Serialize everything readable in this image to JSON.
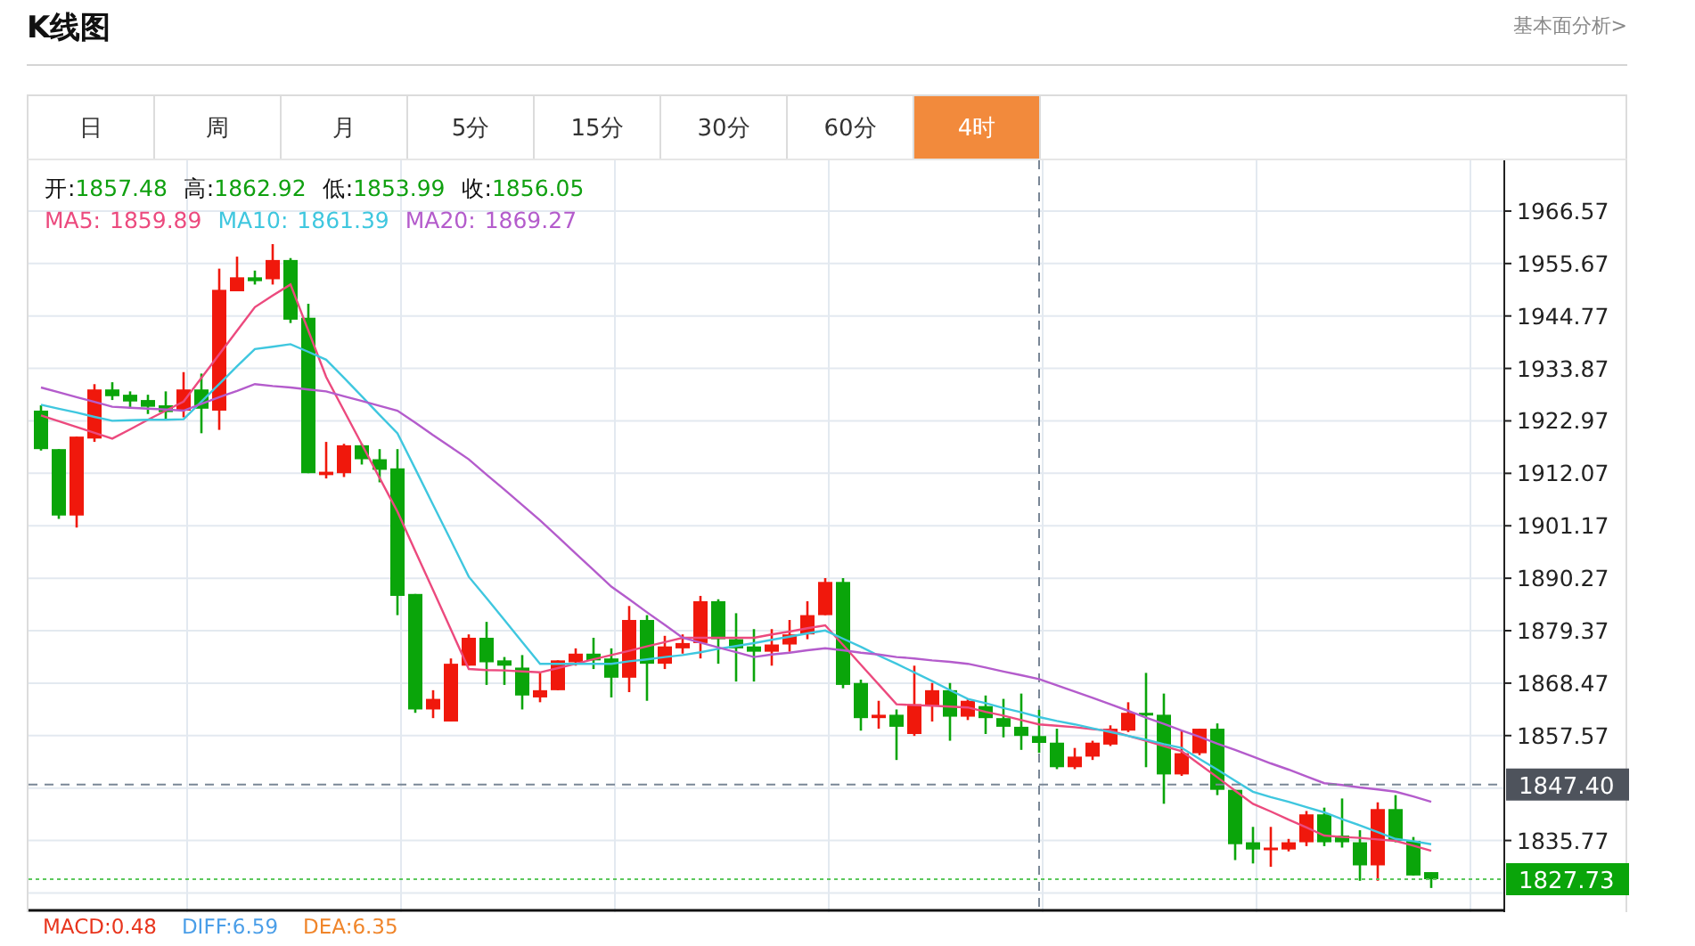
{
  "header": {
    "title": "K线图",
    "link": "基本面分析>"
  },
  "tabs": [
    {
      "label": "日",
      "selected": false
    },
    {
      "label": "周",
      "selected": false
    },
    {
      "label": "月",
      "selected": false
    },
    {
      "label": "5分",
      "selected": false
    },
    {
      "label": "15分",
      "selected": false
    },
    {
      "label": "30分",
      "selected": false
    },
    {
      "label": "60分",
      "selected": false
    },
    {
      "label": "4时",
      "selected": true
    }
  ],
  "legend": {
    "ohlc": [
      {
        "label": "开:",
        "value": "1857.48"
      },
      {
        "label": "高:",
        "value": "1862.92"
      },
      {
        "label": "低:",
        "value": "1853.99"
      },
      {
        "label": "收:",
        "value": "1856.05"
      }
    ],
    "ma": [
      "1859.89",
      "1861.39",
      "1869.27"
    ]
  },
  "chart_data": {
    "type": "candlestick",
    "grid": true,
    "ylim": [
      1821.25,
      1976.74
    ],
    "categories": [
      null,
      null,
      null,
      null,
      null,
      null,
      null,
      null,
      null,
      null,
      null,
      null,
      null,
      null,
      null,
      null,
      null,
      null,
      null,
      null,
      null,
      null,
      null,
      null,
      null,
      null,
      null,
      null,
      null,
      null,
      null,
      null,
      null,
      null,
      null,
      null,
      null,
      null,
      null,
      null,
      null,
      null,
      null,
      null,
      null,
      null,
      null,
      null,
      null,
      null,
      null,
      null,
      null,
      null,
      null,
      null,
      null,
      null,
      null,
      null,
      null,
      null,
      null,
      null,
      null,
      null,
      null,
      null,
      null,
      null,
      null,
      null,
      null,
      null,
      null,
      null,
      null,
      null,
      null
    ],
    "yticks": [
      1966.57,
      1955.67,
      1944.77,
      1933.87,
      1922.97,
      1912.07,
      1901.17,
      1890.27,
      1879.37,
      1868.47,
      1857.57,
      1835.77
    ],
    "ohlc": [
      [
        1925.1,
        1926.2,
        1916.8,
        1917.1
      ],
      [
        1917.1,
        1917.1,
        1902.6,
        1903.3
      ],
      [
        1903.3,
        1919.7,
        1900.8,
        1919.7
      ],
      [
        1919.3,
        1930.6,
        1918.6,
        1929.5
      ],
      [
        1929.5,
        1931.0,
        1927.3,
        1928.1
      ],
      [
        1928.4,
        1929.1,
        1925.5,
        1927.0
      ],
      [
        1927.3,
        1928.4,
        1924.4,
        1925.9
      ],
      [
        1926.2,
        1929.1,
        1923.3,
        1924.8
      ],
      [
        1925.1,
        1933.1,
        1923.7,
        1929.5
      ],
      [
        1929.5,
        1932.8,
        1920.4,
        1925.5
      ],
      [
        1925.1,
        1954.6,
        1921.1,
        1950.2
      ],
      [
        1949.9,
        1957.1,
        1949.9,
        1952.8
      ],
      [
        1952.8,
        1954.2,
        1951.3,
        1952.0
      ],
      [
        1952.4,
        1959.7,
        1951.3,
        1956.4
      ],
      [
        1956.4,
        1956.8,
        1943.3,
        1944.0
      ],
      [
        1944.4,
        1947.3,
        1912.1,
        1912.1
      ],
      [
        1911.7,
        1918.6,
        1911.0,
        1912.4
      ],
      [
        1912.1,
        1918.2,
        1911.3,
        1917.9
      ],
      [
        1917.9,
        1918.2,
        1913.9,
        1915.0
      ],
      [
        1915.0,
        1917.1,
        1910.2,
        1912.8
      ],
      [
        1913.1,
        1917.1,
        1882.6,
        1886.6
      ],
      [
        1887.0,
        1887.0,
        1862.3,
        1863.0
      ],
      [
        1863.0,
        1867.0,
        1861.2,
        1865.2
      ],
      [
        1860.5,
        1873.6,
        1860.5,
        1872.5
      ],
      [
        1872.1,
        1878.6,
        1872.1,
        1877.9
      ],
      [
        1877.9,
        1881.2,
        1868.1,
        1872.8
      ],
      [
        1873.2,
        1873.9,
        1868.1,
        1872.1
      ],
      [
        1871.7,
        1874.3,
        1863.0,
        1865.9
      ],
      [
        1865.5,
        1870.6,
        1864.5,
        1867.0
      ],
      [
        1867.0,
        1873.2,
        1867.0,
        1873.2
      ],
      [
        1872.8,
        1875.7,
        1872.1,
        1874.6
      ],
      [
        1874.6,
        1877.9,
        1871.4,
        1873.2
      ],
      [
        1873.6,
        1875.7,
        1865.5,
        1869.6
      ],
      [
        1869.6,
        1884.5,
        1866.6,
        1881.6
      ],
      [
        1881.6,
        1882.6,
        1864.8,
        1872.5
      ],
      [
        1872.5,
        1878.3,
        1871.4,
        1876.1
      ],
      [
        1875.7,
        1878.6,
        1874.6,
        1876.8
      ],
      [
        1876.8,
        1886.6,
        1873.6,
        1885.5
      ],
      [
        1885.5,
        1885.9,
        1872.5,
        1877.6
      ],
      [
        1877.6,
        1883.0,
        1868.8,
        1875.7
      ],
      [
        1876.1,
        1879.7,
        1868.8,
        1875.0
      ],
      [
        1875.0,
        1879.7,
        1872.1,
        1876.5
      ],
      [
        1876.5,
        1881.6,
        1875.0,
        1878.6
      ],
      [
        1878.6,
        1885.5,
        1877.6,
        1882.6
      ],
      [
        1882.6,
        1890.3,
        1882.6,
        1889.5
      ],
      [
        1889.5,
        1890.3,
        1867.4,
        1868.1
      ],
      [
        1868.5,
        1869.2,
        1858.6,
        1861.2
      ],
      [
        1861.2,
        1864.8,
        1859.0,
        1861.9
      ],
      [
        1861.9,
        1863.0,
        1852.5,
        1859.4
      ],
      [
        1857.9,
        1872.1,
        1857.5,
        1864.1
      ],
      [
        1863.7,
        1868.5,
        1860.5,
        1867.0
      ],
      [
        1867.0,
        1868.5,
        1856.5,
        1861.5
      ],
      [
        1861.5,
        1865.2,
        1860.8,
        1864.8
      ],
      [
        1863.7,
        1865.9,
        1857.9,
        1861.2
      ],
      [
        1861.2,
        1865.2,
        1857.2,
        1859.4
      ],
      [
        1859.4,
        1866.3,
        1854.6,
        1857.5
      ],
      [
        1857.48,
        1862.92,
        1853.99,
        1856.05
      ],
      [
        1856.1,
        1859.0,
        1850.6,
        1851.0
      ],
      [
        1851.0,
        1855.0,
        1850.6,
        1853.2
      ],
      [
        1853.2,
        1856.5,
        1852.5,
        1856.1
      ],
      [
        1855.7,
        1859.7,
        1855.4,
        1859.0
      ],
      [
        1858.6,
        1864.5,
        1858.3,
        1862.3
      ],
      [
        1862.3,
        1870.6,
        1851.0,
        1861.9
      ],
      [
        1861.9,
        1866.3,
        1843.4,
        1849.5
      ],
      [
        1849.5,
        1858.6,
        1849.2,
        1853.9
      ],
      [
        1853.9,
        1859.0,
        1853.5,
        1859.0
      ],
      [
        1859.0,
        1860.1,
        1845.2,
        1846.3
      ],
      [
        1846.3,
        1846.3,
        1831.7,
        1835.0
      ],
      [
        1835.4,
        1838.6,
        1831.0,
        1833.9
      ],
      [
        1833.9,
        1838.6,
        1830.3,
        1834.3
      ],
      [
        1833.9,
        1836.1,
        1833.5,
        1835.4
      ],
      [
        1835.4,
        1841.9,
        1834.6,
        1841.2
      ],
      [
        1841.2,
        1842.6,
        1834.6,
        1835.4
      ],
      [
        1836.8,
        1844.5,
        1834.3,
        1835.4
      ],
      [
        1835.4,
        1837.9,
        1827.4,
        1830.6
      ],
      [
        1830.6,
        1843.7,
        1827.4,
        1842.3
      ],
      [
        1842.3,
        1845.2,
        1835.4,
        1835.7
      ],
      [
        1835.7,
        1836.5,
        1828.5,
        1828.5
      ],
      [
        1829.2,
        1829.2,
        1825.9,
        1827.73
      ]
    ],
    "series": [
      {
        "name": "MA5:",
        "type": "line",
        "color": "#ec4a7e",
        "values": [
          1924.1,
          1922.9,
          1921.7,
          1920.5,
          1919.3,
          1921.2,
          1923.2,
          1925.1,
          1927.0,
          1931.9,
          1936.8,
          1941.7,
          1946.6,
          1949.0,
          1951.3,
          1941.7,
          1932.1,
          1925.1,
          1918.1,
          1911.1,
          1904.1,
          1895.9,
          1887.8,
          1879.6,
          1871.4,
          1871.2,
          1871.1,
          1870.9,
          1870.7,
          1871.6,
          1872.5,
          1873.4,
          1874.3,
          1875.2,
          1876.1,
          1877.0,
          1877.9,
          1877.9,
          1877.9,
          1877.9,
          1877.9,
          1878.6,
          1879.2,
          1879.9,
          1880.5,
          1876.4,
          1872.3,
          1868.2,
          1864.1,
          1863.9,
          1863.8,
          1863.6,
          1863.4,
          1862.5,
          1861.7,
          1860.8,
          1859.9,
          1859.6,
          1859.3,
          1858.9,
          1858.6,
          1857.5,
          1856.5,
          1855.4,
          1854.3,
          1851.6,
          1848.9,
          1846.1,
          1843.4,
          1841.8,
          1840.1,
          1838.5,
          1836.8,
          1836.5,
          1836.3,
          1836.0,
          1835.7,
          1834.7,
          1833.6
        ]
      },
      {
        "name": "MA10:",
        "type": "line",
        "color": "#3fc7df",
        "values": [
          1926.3,
          1925.5,
          1924.7,
          1923.8,
          1923.0,
          1923.1,
          1923.2,
          1923.2,
          1923.3,
          1927.0,
          1930.6,
          1934.3,
          1937.9,
          1938.4,
          1938.9,
          1937.3,
          1935.7,
          1931.9,
          1928.1,
          1924.2,
          1920.4,
          1913.0,
          1905.5,
          1898.1,
          1890.6,
          1886.1,
          1881.6,
          1877.0,
          1872.5,
          1872.5,
          1872.5,
          1872.5,
          1872.5,
          1873.0,
          1873.4,
          1873.9,
          1874.3,
          1874.9,
          1875.6,
          1876.2,
          1876.8,
          1877.5,
          1878.1,
          1878.8,
          1879.4,
          1877.7,
          1876.0,
          1874.2,
          1872.5,
          1870.7,
          1868.9,
          1867.0,
          1865.2,
          1864.3,
          1863.3,
          1862.4,
          1861.4,
          1860.6,
          1859.9,
          1859.1,
          1858.3,
          1857.5,
          1856.7,
          1855.8,
          1855.0,
          1852.7,
          1850.5,
          1848.2,
          1845.9,
          1844.8,
          1843.8,
          1842.7,
          1841.6,
          1840.2,
          1838.9,
          1837.5,
          1836.1,
          1835.6,
          1835.0
        ]
      },
      {
        "name": "MA20:",
        "type": "line",
        "color": "#b45ccc",
        "values": [
          1929.9,
          1928.9,
          1927.9,
          1926.9,
          1925.9,
          1925.7,
          1925.5,
          1925.3,
          1925.1,
          1926.5,
          1927.9,
          1929.2,
          1930.6,
          1930.2,
          1929.9,
          1929.5,
          1929.1,
          1928.1,
          1927.1,
          1926.1,
          1925.1,
          1922.6,
          1920.0,
          1917.5,
          1915.0,
          1911.8,
          1908.7,
          1905.5,
          1902.3,
          1898.9,
          1895.4,
          1892.0,
          1888.5,
          1885.9,
          1883.2,
          1880.6,
          1877.9,
          1876.9,
          1875.9,
          1874.9,
          1873.9,
          1874.4,
          1874.8,
          1875.3,
          1875.7,
          1875.3,
          1874.8,
          1874.4,
          1873.9,
          1873.6,
          1873.2,
          1872.9,
          1872.5,
          1871.7,
          1870.9,
          1870.1,
          1869.3,
          1868.0,
          1866.7,
          1865.4,
          1864.1,
          1862.7,
          1861.3,
          1860.0,
          1858.6,
          1857.3,
          1855.9,
          1854.6,
          1853.2,
          1851.8,
          1850.5,
          1849.1,
          1847.7,
          1847.3,
          1846.8,
          1846.4,
          1845.9,
          1844.9,
          1843.8
        ]
      }
    ],
    "ref_lines": [
      {
        "axis": "y",
        "value": 1847.4
      },
      {
        "axis": "y",
        "value": 1827.73
      }
    ]
  },
  "price_tags": [
    "1847.40",
    "1827.73"
  ],
  "indicators": [
    {
      "text": "MACD:0.48",
      "color": "#e8341c"
    },
    {
      "text": "DIFF:6.59",
      "color": "#4a9ee8"
    },
    {
      "text": "DEA:6.35",
      "color": "#f0852a"
    }
  ]
}
